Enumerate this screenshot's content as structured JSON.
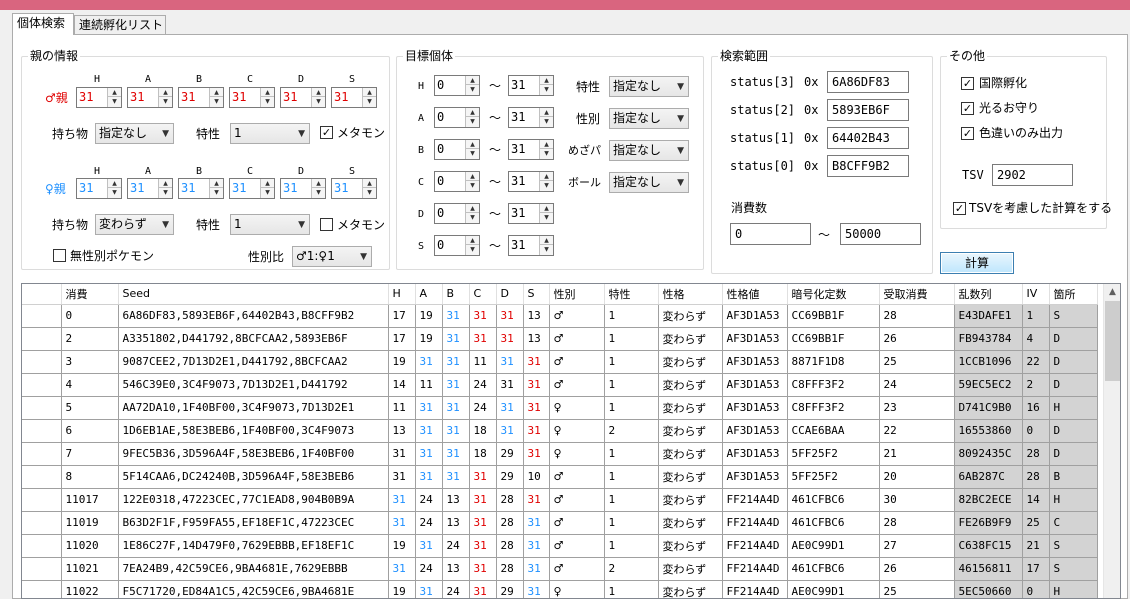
{
  "tabs": [
    "個体検索",
    "連続孵化リスト"
  ],
  "parent": {
    "title": "親の情報",
    "stat_headers": [
      "H",
      "A",
      "B",
      "C",
      "D",
      "S"
    ],
    "male_label": "♂親",
    "male_ivs": [
      "31",
      "31",
      "31",
      "31",
      "31",
      "31"
    ],
    "female_label": "♀親",
    "female_ivs": [
      "31",
      "31",
      "31",
      "31",
      "31",
      "31"
    ],
    "item_label": "持ち物",
    "ability_label": "特性",
    "male_item": "指定なし",
    "male_ability": "1",
    "female_item": "変わらず",
    "female_ability": "1",
    "ditto_label": "メタモン",
    "male_ditto": true,
    "female_ditto": false,
    "genderless_label": "無性別ポケモン",
    "genderless": false,
    "ratio_label": "性別比",
    "ratio_value": "♂1:♀1"
  },
  "target": {
    "title": "目標個体",
    "stats": [
      {
        "label": "H",
        "min": "0",
        "max": "31"
      },
      {
        "label": "A",
        "min": "0",
        "max": "31"
      },
      {
        "label": "B",
        "min": "0",
        "max": "31"
      },
      {
        "label": "C",
        "min": "0",
        "max": "31"
      },
      {
        "label": "D",
        "min": "0",
        "max": "31"
      },
      {
        "label": "S",
        "min": "0",
        "max": "31"
      }
    ],
    "tilde": "～",
    "filters": [
      {
        "label": "特性",
        "value": "指定なし"
      },
      {
        "label": "性別",
        "value": "指定なし"
      },
      {
        "label": "めざパ",
        "value": "指定なし"
      },
      {
        "label": "ボール",
        "value": "指定なし"
      }
    ]
  },
  "range": {
    "title": "検索範囲",
    "status": [
      {
        "label": "status[3]",
        "prefix": "0x",
        "value": "6A86DF83"
      },
      {
        "label": "status[2]",
        "prefix": "0x",
        "value": "5893EB6F"
      },
      {
        "label": "status[1]",
        "prefix": "0x",
        "value": "64402B43"
      },
      {
        "label": "status[0]",
        "prefix": "0x",
        "value": "B8CFF9B2"
      }
    ],
    "consume_label": "消費数",
    "consume_min": "0",
    "consume_max": "50000",
    "tilde": "～"
  },
  "other": {
    "title": "その他",
    "international": "国際孵化",
    "shiny_charm": "光るお守り",
    "shiny_only": "色違いのみ出力",
    "tsv_label": "TSV",
    "tsv_value": "2902",
    "tsv_consider": "TSVを考慮した計算をする"
  },
  "calc_button": "計算",
  "grid": {
    "columns": [
      "消費",
      "Seed",
      "H",
      "A",
      "B",
      "C",
      "D",
      "S",
      "性別",
      "特性",
      "性格",
      "性格値",
      "暗号化定数",
      "受取消費",
      "乱数列",
      "IV",
      "箇所"
    ],
    "rows": [
      [
        "0",
        "6A86DF83,5893EB6F,64402B43,B8CFF9B2",
        "17",
        "19",
        "31",
        "31",
        "31",
        "13",
        "♂",
        "1",
        "変わらず",
        "AF3D1A53",
        "CC69BB1F",
        "28",
        "E43DAFE1",
        "1",
        "S"
      ],
      [
        "2",
        "A3351802,D441792,8BCFCAA2,5893EB6F",
        "17",
        "19",
        "31",
        "31",
        "31",
        "13",
        "♂",
        "1",
        "変わらず",
        "AF3D1A53",
        "CC69BB1F",
        "26",
        "FB943784",
        "4",
        "D"
      ],
      [
        "3",
        "9087CEE2,7D13D2E1,D441792,8BCFCAA2",
        "19",
        "31",
        "31",
        "11",
        "31",
        "31",
        "♂",
        "1",
        "変わらず",
        "AF3D1A53",
        "8871F1D8",
        "25",
        "1CCB1096",
        "22",
        "D"
      ],
      [
        "4",
        "546C39E0,3C4F9073,7D13D2E1,D441792",
        "14",
        "11",
        "31",
        "24",
        "31",
        "31",
        "♂",
        "1",
        "変わらず",
        "AF3D1A53",
        "C8FFF3F2",
        "24",
        "59EC5EC2",
        "2",
        "D"
      ],
      [
        "5",
        "AA72DA10,1F40BF00,3C4F9073,7D13D2E1",
        "11",
        "31",
        "31",
        "24",
        "31",
        "31",
        "♀",
        "1",
        "変わらず",
        "AF3D1A53",
        "C8FFF3F2",
        "23",
        "D741C9B0",
        "16",
        "H"
      ],
      [
        "6",
        "1D6EB1AE,58E3BEB6,1F40BF00,3C4F9073",
        "13",
        "31",
        "31",
        "18",
        "31",
        "31",
        "♀",
        "2",
        "変わらず",
        "AF3D1A53",
        "CCAE6BAA",
        "22",
        "16553860",
        "0",
        "D"
      ],
      [
        "7",
        "9FEC5B36,3D596A4F,58E3BEB6,1F40BF00",
        "31",
        "31",
        "31",
        "18",
        "29",
        "31",
        "♀",
        "1",
        "変わらず",
        "AF3D1A53",
        "5FF25F2",
        "21",
        "8092435C",
        "28",
        "D"
      ],
      [
        "8",
        "5F14CAA6,DC24240B,3D596A4F,58E3BEB6",
        "31",
        "31",
        "31",
        "31",
        "29",
        "10",
        "♂",
        "1",
        "変わらず",
        "AF3D1A53",
        "5FF25F2",
        "20",
        "6AB287C",
        "28",
        "B"
      ],
      [
        "11017",
        "122E0318,47223CEC,77C1EAD8,904B0B9A",
        "31",
        "24",
        "13",
        "31",
        "28",
        "31",
        "♂",
        "1",
        "変わらず",
        "FF214A4D",
        "461CFBC6",
        "30",
        "82BC2ECE",
        "14",
        "H"
      ],
      [
        "11019",
        "B63D2F1F,F959FA55,EF18EF1C,47223CEC",
        "31",
        "24",
        "13",
        "31",
        "28",
        "31",
        "♂",
        "1",
        "変わらず",
        "FF214A4D",
        "461CFBC6",
        "28",
        "FE26B9F9",
        "25",
        "C"
      ],
      [
        "11020",
        "1E86C27F,14D479F0,7629EBBB,EF18EF1C",
        "19",
        "31",
        "24",
        "31",
        "28",
        "31",
        "♂",
        "1",
        "変わらず",
        "FF214A4D",
        "AE0C99D1",
        "27",
        "C638FC15",
        "21",
        "S"
      ],
      [
        "11021",
        "7EA24B9,42C59CE6,9BA4681E,7629EBBB",
        "31",
        "24",
        "13",
        "31",
        "28",
        "31",
        "♂",
        "2",
        "変わらず",
        "FF214A4D",
        "461CFBC6",
        "26",
        "46156811",
        "17",
        "S"
      ],
      [
        "11022",
        "F5C71720,ED84A1C5,42C59CE6,9BA4681E",
        "19",
        "31",
        "24",
        "31",
        "29",
        "31",
        "♀",
        "1",
        "変わらず",
        "FF214A4D",
        "AE0C99D1",
        "25",
        "5EC50660",
        "0",
        "H"
      ]
    ],
    "iv_colors": [
      [
        "",
        "",
        "b",
        "r",
        "r",
        "",
        ""
      ],
      [
        "",
        "",
        "b",
        "r",
        "r",
        "",
        ""
      ],
      [
        "",
        "b",
        "b",
        "",
        "b",
        "r",
        ""
      ],
      [
        "",
        "",
        "b",
        "",
        "",
        "r",
        ""
      ],
      [
        "",
        "b",
        "b",
        "",
        "b",
        "r",
        ""
      ],
      [
        "",
        "b",
        "b",
        "",
        "b",
        "r",
        ""
      ],
      [
        "",
        "b",
        "b",
        "",
        "",
        "r",
        ""
      ],
      [
        "",
        "b",
        "b",
        "r",
        "",
        "",
        ""
      ],
      [
        "b",
        "",
        "",
        "r",
        "",
        "r",
        ""
      ],
      [
        "b",
        "",
        "",
        "r",
        "",
        "b",
        ""
      ],
      [
        "",
        "b",
        "",
        "r",
        "",
        "b",
        ""
      ],
      [
        "b",
        "",
        "",
        "r",
        "",
        "b",
        ""
      ],
      [
        "",
        "b",
        "",
        "r",
        "",
        "b",
        ""
      ]
    ]
  }
}
